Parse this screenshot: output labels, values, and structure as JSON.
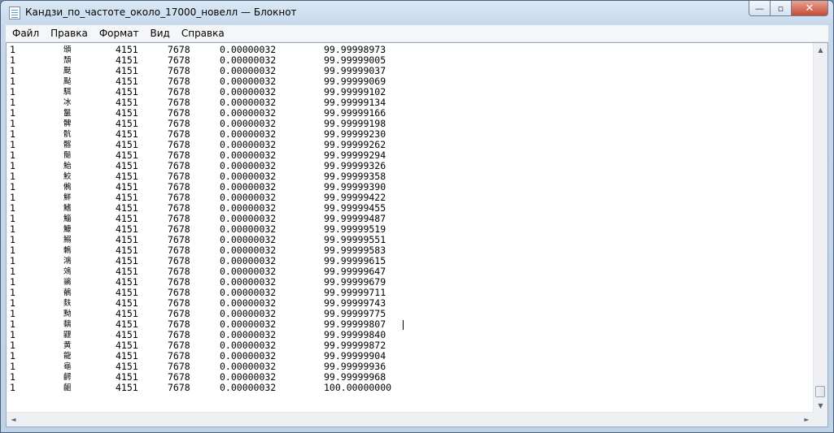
{
  "window": {
    "title": "Кандзи_по_частоте_около_17000_новелл — Блокнот",
    "controls": {
      "minimize": "—",
      "maximize": "▫",
      "close": "✕"
    }
  },
  "menu": [
    "Файл",
    "Правка",
    "Формат",
    "Вид",
    "Справка"
  ],
  "rows": [
    [
      "1",
      "頒",
      "4151",
      "7678",
      "0.00000032",
      "99.99998973"
    ],
    [
      "1",
      "頹",
      "4151",
      "7678",
      "0.00000032",
      "99.99999005"
    ],
    [
      "1",
      "颫",
      "4151",
      "7678",
      "0.00000032",
      "99.99999037"
    ],
    [
      "1",
      "颭",
      "4151",
      "7678",
      "0.00000032",
      "99.99999069"
    ],
    [
      "1",
      "駬",
      "4151",
      "7678",
      "0.00000032",
      "99.99999102"
    ],
    [
      "1",
      "冰",
      "4151",
      "7678",
      "0.00000032",
      "99.99999134"
    ],
    [
      "1",
      "鬣",
      "4151",
      "7678",
      "0.00000032",
      "99.99999166"
    ],
    [
      "1",
      "髀",
      "4151",
      "7678",
      "0.00000032",
      "99.99999198"
    ],
    [
      "1",
      "骯",
      "4151",
      "7678",
      "0.00000032",
      "99.99999230"
    ],
    [
      "1",
      "髂",
      "4151",
      "7678",
      "0.00000032",
      "99.99999262"
    ],
    [
      "1",
      "鬜",
      "4151",
      "7678",
      "0.00000032",
      "99.99999294"
    ],
    [
      "1",
      "鮐",
      "4151",
      "7678",
      "0.00000032",
      "99.99999326"
    ],
    [
      "1",
      "鮫",
      "4151",
      "7678",
      "0.00000032",
      "99.99999358"
    ],
    [
      "1",
      "鵂",
      "4151",
      "7678",
      "0.00000032",
      "99.99999390"
    ],
    [
      "1",
      "鮮",
      "4151",
      "7678",
      "0.00000032",
      "99.99999422"
    ],
    [
      "1",
      "鰭",
      "4151",
      "7678",
      "0.00000032",
      "99.99999455"
    ],
    [
      "1",
      "鯔",
      "4151",
      "7678",
      "0.00000032",
      "99.99999487"
    ],
    [
      "1",
      "鱇",
      "4151",
      "7678",
      "0.00000032",
      "99.99999519"
    ],
    [
      "1",
      "鰯",
      "4151",
      "7678",
      "0.00000032",
      "99.99999551"
    ],
    [
      "1",
      "鶇",
      "4151",
      "7678",
      "0.00000032",
      "99.99999583"
    ],
    [
      "1",
      "鴻",
      "4151",
      "7678",
      "0.00000032",
      "99.99999615"
    ],
    [
      "1",
      "鵁",
      "4151",
      "7678",
      "0.00000032",
      "99.99999647"
    ],
    [
      "1",
      "鶲",
      "4151",
      "7678",
      "0.00000032",
      "99.99999679"
    ],
    [
      "1",
      "鶺",
      "4151",
      "7678",
      "0.00000032",
      "99.99999711"
    ],
    [
      "1",
      "麩",
      "4151",
      "7678",
      "0.00000032",
      "99.99999743"
    ],
    [
      "1",
      "黝",
      "4151",
      "7678",
      "0.00000032",
      "99.99999775"
    ],
    [
      "1",
      "黐",
      "4151",
      "7678",
      "0.00000032",
      "99.99999807"
    ],
    [
      "1",
      "鼴",
      "4151",
      "7678",
      "0.00000032",
      "99.99999840"
    ],
    [
      "1",
      "黄",
      "4151",
      "7678",
      "0.00000032",
      "99.99999872"
    ],
    [
      "1",
      "龍",
      "4151",
      "7678",
      "0.00000032",
      "99.99999904"
    ],
    [
      "1",
      "龜",
      "4151",
      "7678",
      "0.00000032",
      "99.99999936"
    ],
    [
      "1",
      "齶",
      "4151",
      "7678",
      "0.00000032",
      "99.99999968"
    ],
    [
      "1",
      "齟",
      "4151",
      "7678",
      "0.00000032",
      "100.00000000"
    ]
  ],
  "scroll": {
    "up": "▲",
    "down": "▼",
    "left": "◄",
    "right": "►"
  }
}
